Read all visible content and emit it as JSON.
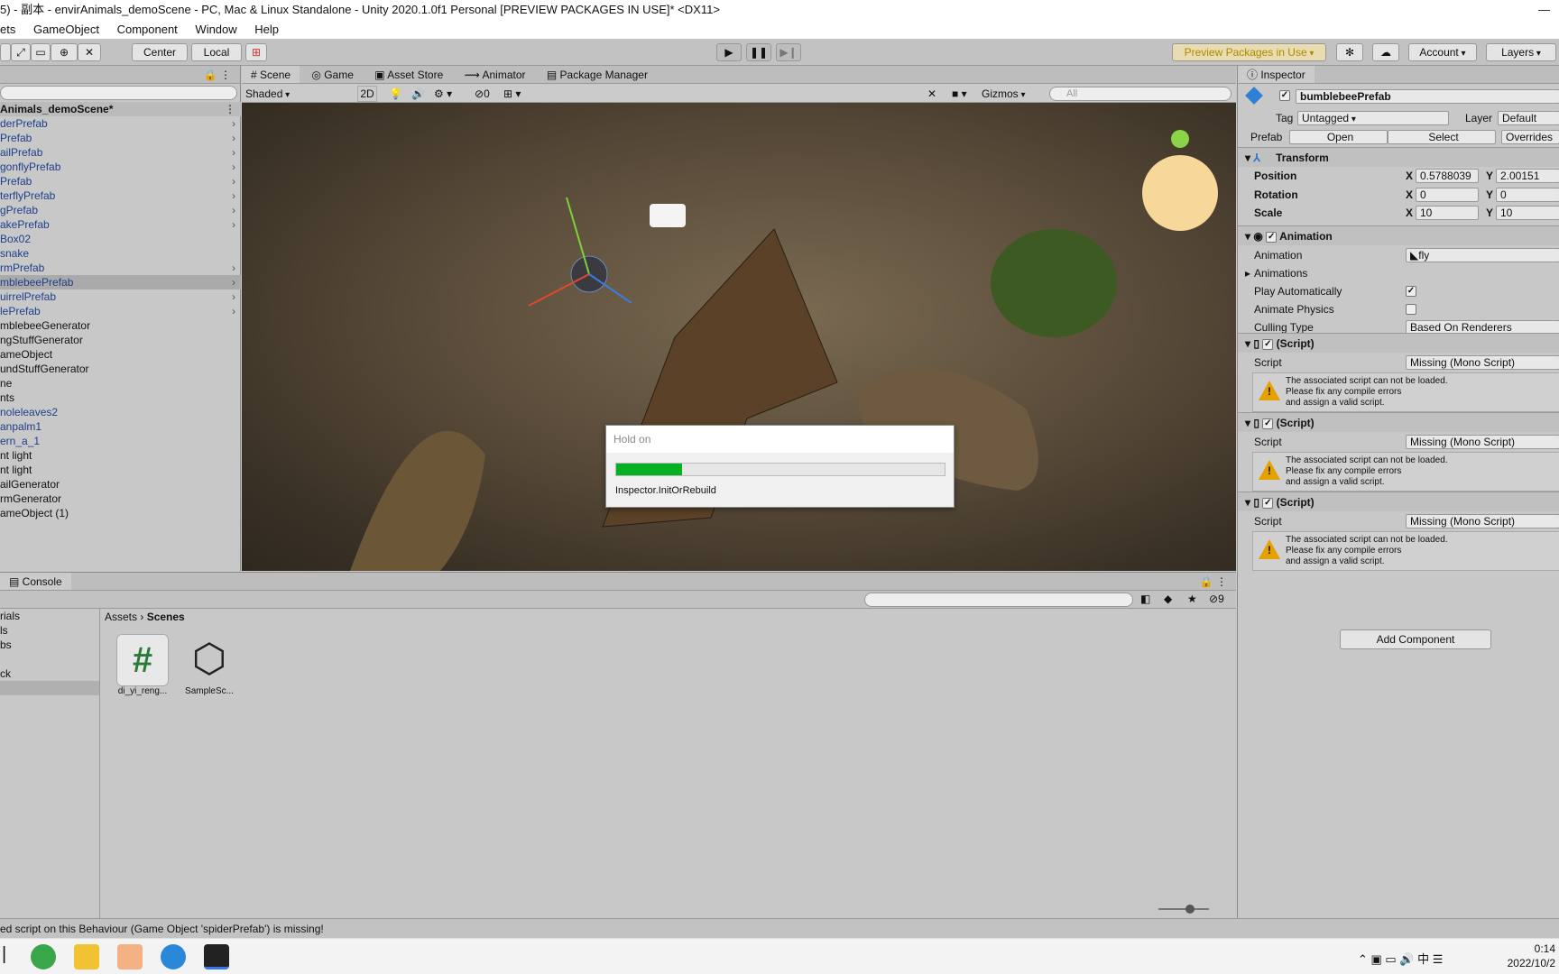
{
  "window": {
    "title": "5) - 副本 - envirAnimals_demoScene - PC, Mac & Linux Standalone - Unity 2020.1.0f1 Personal [PREVIEW PACKAGES IN USE]* <DX11>",
    "minimize_glyph": "—"
  },
  "menu": [
    "ets",
    "GameObject",
    "Component",
    "Window",
    "Help"
  ],
  "toolbar": {
    "pivot": "Center",
    "space": "Local",
    "preview_packages": "Preview Packages in Use",
    "account": "Account",
    "layers": "Layers"
  },
  "hierarchy": {
    "scene_name": "Animals_demoScene*",
    "items": [
      {
        "label": "derPrefab",
        "blue": true,
        "arrow": true
      },
      {
        "label": "Prefab",
        "blue": true,
        "arrow": true
      },
      {
        "label": "ailPrefab",
        "blue": true,
        "arrow": true
      },
      {
        "label": "gonflyPrefab",
        "blue": true,
        "arrow": true
      },
      {
        "label": "Prefab",
        "blue": true,
        "arrow": true
      },
      {
        "label": "terflyPrefab",
        "blue": true,
        "arrow": true
      },
      {
        "label": "gPrefab",
        "blue": true,
        "arrow": true
      },
      {
        "label": "akePrefab",
        "blue": true,
        "arrow": true
      },
      {
        "label": "Box02",
        "blue": true,
        "arrow": false
      },
      {
        "label": "snake",
        "blue": true,
        "arrow": false
      },
      {
        "label": "rmPrefab",
        "blue": true,
        "arrow": true
      },
      {
        "label": "mblebeePrefab",
        "blue": true,
        "arrow": true,
        "selected": true
      },
      {
        "label": "uirrelPrefab",
        "blue": true,
        "arrow": true
      },
      {
        "label": "lePrefab",
        "blue": true,
        "arrow": true
      },
      {
        "label": "mblebeeGenerator",
        "blue": false,
        "arrow": false
      },
      {
        "label": "ngStuffGenerator",
        "blue": false,
        "arrow": false
      },
      {
        "label": "ameObject",
        "blue": false,
        "arrow": false
      },
      {
        "label": "undStuffGenerator",
        "blue": false,
        "arrow": false
      },
      {
        "label": "ne",
        "blue": false,
        "arrow": false
      },
      {
        "label": "nts",
        "blue": false,
        "arrow": false
      },
      {
        "label": "noleleaves2",
        "blue": true,
        "arrow": false
      },
      {
        "label": "anpalm1",
        "blue": true,
        "arrow": false
      },
      {
        "label": "ern_a_1",
        "blue": true,
        "arrow": false
      },
      {
        "label": "nt light",
        "blue": false,
        "arrow": false
      },
      {
        "label": "nt light",
        "blue": false,
        "arrow": false
      },
      {
        "label": "ailGenerator",
        "blue": false,
        "arrow": false
      },
      {
        "label": "rmGenerator",
        "blue": false,
        "arrow": false
      },
      {
        "label": "ameObject (1)",
        "blue": false,
        "arrow": false
      }
    ]
  },
  "scene_tabs": [
    "Scene",
    "Game",
    "Asset Store",
    "Animator",
    "Package Manager"
  ],
  "scene_bar": {
    "shading": "Shaded",
    "mode_2d": "2D",
    "hidden_count": "0",
    "gizmos": "Gizmos",
    "search_placeholder": "All"
  },
  "dialog": {
    "title": "Hold on",
    "progress": 0.2,
    "message": "Inspector.InitOrRebuild"
  },
  "inspector": {
    "tab": "Inspector",
    "object_name": "bumblebeePrefab",
    "tag_label": "Tag",
    "tag": "Untagged",
    "layer_label": "Layer",
    "layer": "Default",
    "prefab_label": "Prefab",
    "open": "Open",
    "select": "Select",
    "overrides": "Overrides",
    "transform": {
      "title": "Transform",
      "position_label": "Position",
      "pos_x": "0.5788039",
      "pos_y": "2.00151",
      "rotation_label": "Rotation",
      "rot_x": "0",
      "rot_y": "0",
      "scale_label": "Scale",
      "scale_x": "10",
      "scale_y": "10"
    },
    "animation": {
      "title": "Animation",
      "animation_label": "Animation",
      "animation_value": "fly",
      "animations_label": "Animations",
      "play_auto_label": "Play Automatically",
      "play_auto": true,
      "physics_label": "Animate Physics",
      "physics": false,
      "culling_label": "Culling Type",
      "culling": "Based On Renderers"
    },
    "scripts": [
      {
        "title": "(Script)",
        "script_label": "Script",
        "value": "Missing (Mono Script)",
        "warning": [
          "The associated script can not be loaded.",
          "Please fix any compile errors",
          "and assign a valid script."
        ]
      },
      {
        "title": "(Script)",
        "script_label": "Script",
        "value": "Missing (Mono Script)",
        "warning": [
          "The associated script can not be loaded.",
          "Please fix any compile errors",
          "and assign a valid script."
        ]
      },
      {
        "title": "(Script)",
        "script_label": "Script",
        "value": "Missing (Mono Script)",
        "warning": [
          "The associated script can not be loaded.",
          "Please fix any compile errors",
          "and assign a valid script."
        ]
      }
    ],
    "add_component": "Add Component"
  },
  "console": {
    "tab": "Console",
    "hidden_count": "9"
  },
  "project": {
    "folders": [
      "rials",
      "ls",
      "bs",
      "",
      "ck",
      ""
    ],
    "breadcrumb": [
      "Assets",
      "Scenes"
    ],
    "assets": [
      {
        "name": "di_yi_reng...",
        "icon": "csharp-script-icon"
      },
      {
        "name": "SampleSc...",
        "icon": "unity-scene-icon"
      }
    ]
  },
  "status": "ed script on this Behaviour (Game Object 'spiderPrefab') is missing!",
  "taskbar": {
    "time": "0:14",
    "date": "2022/10/2"
  },
  "colors": {
    "accent_green": "#06b025",
    "prefab_blue": "#1c3f8a",
    "warning": "#e5a100"
  }
}
